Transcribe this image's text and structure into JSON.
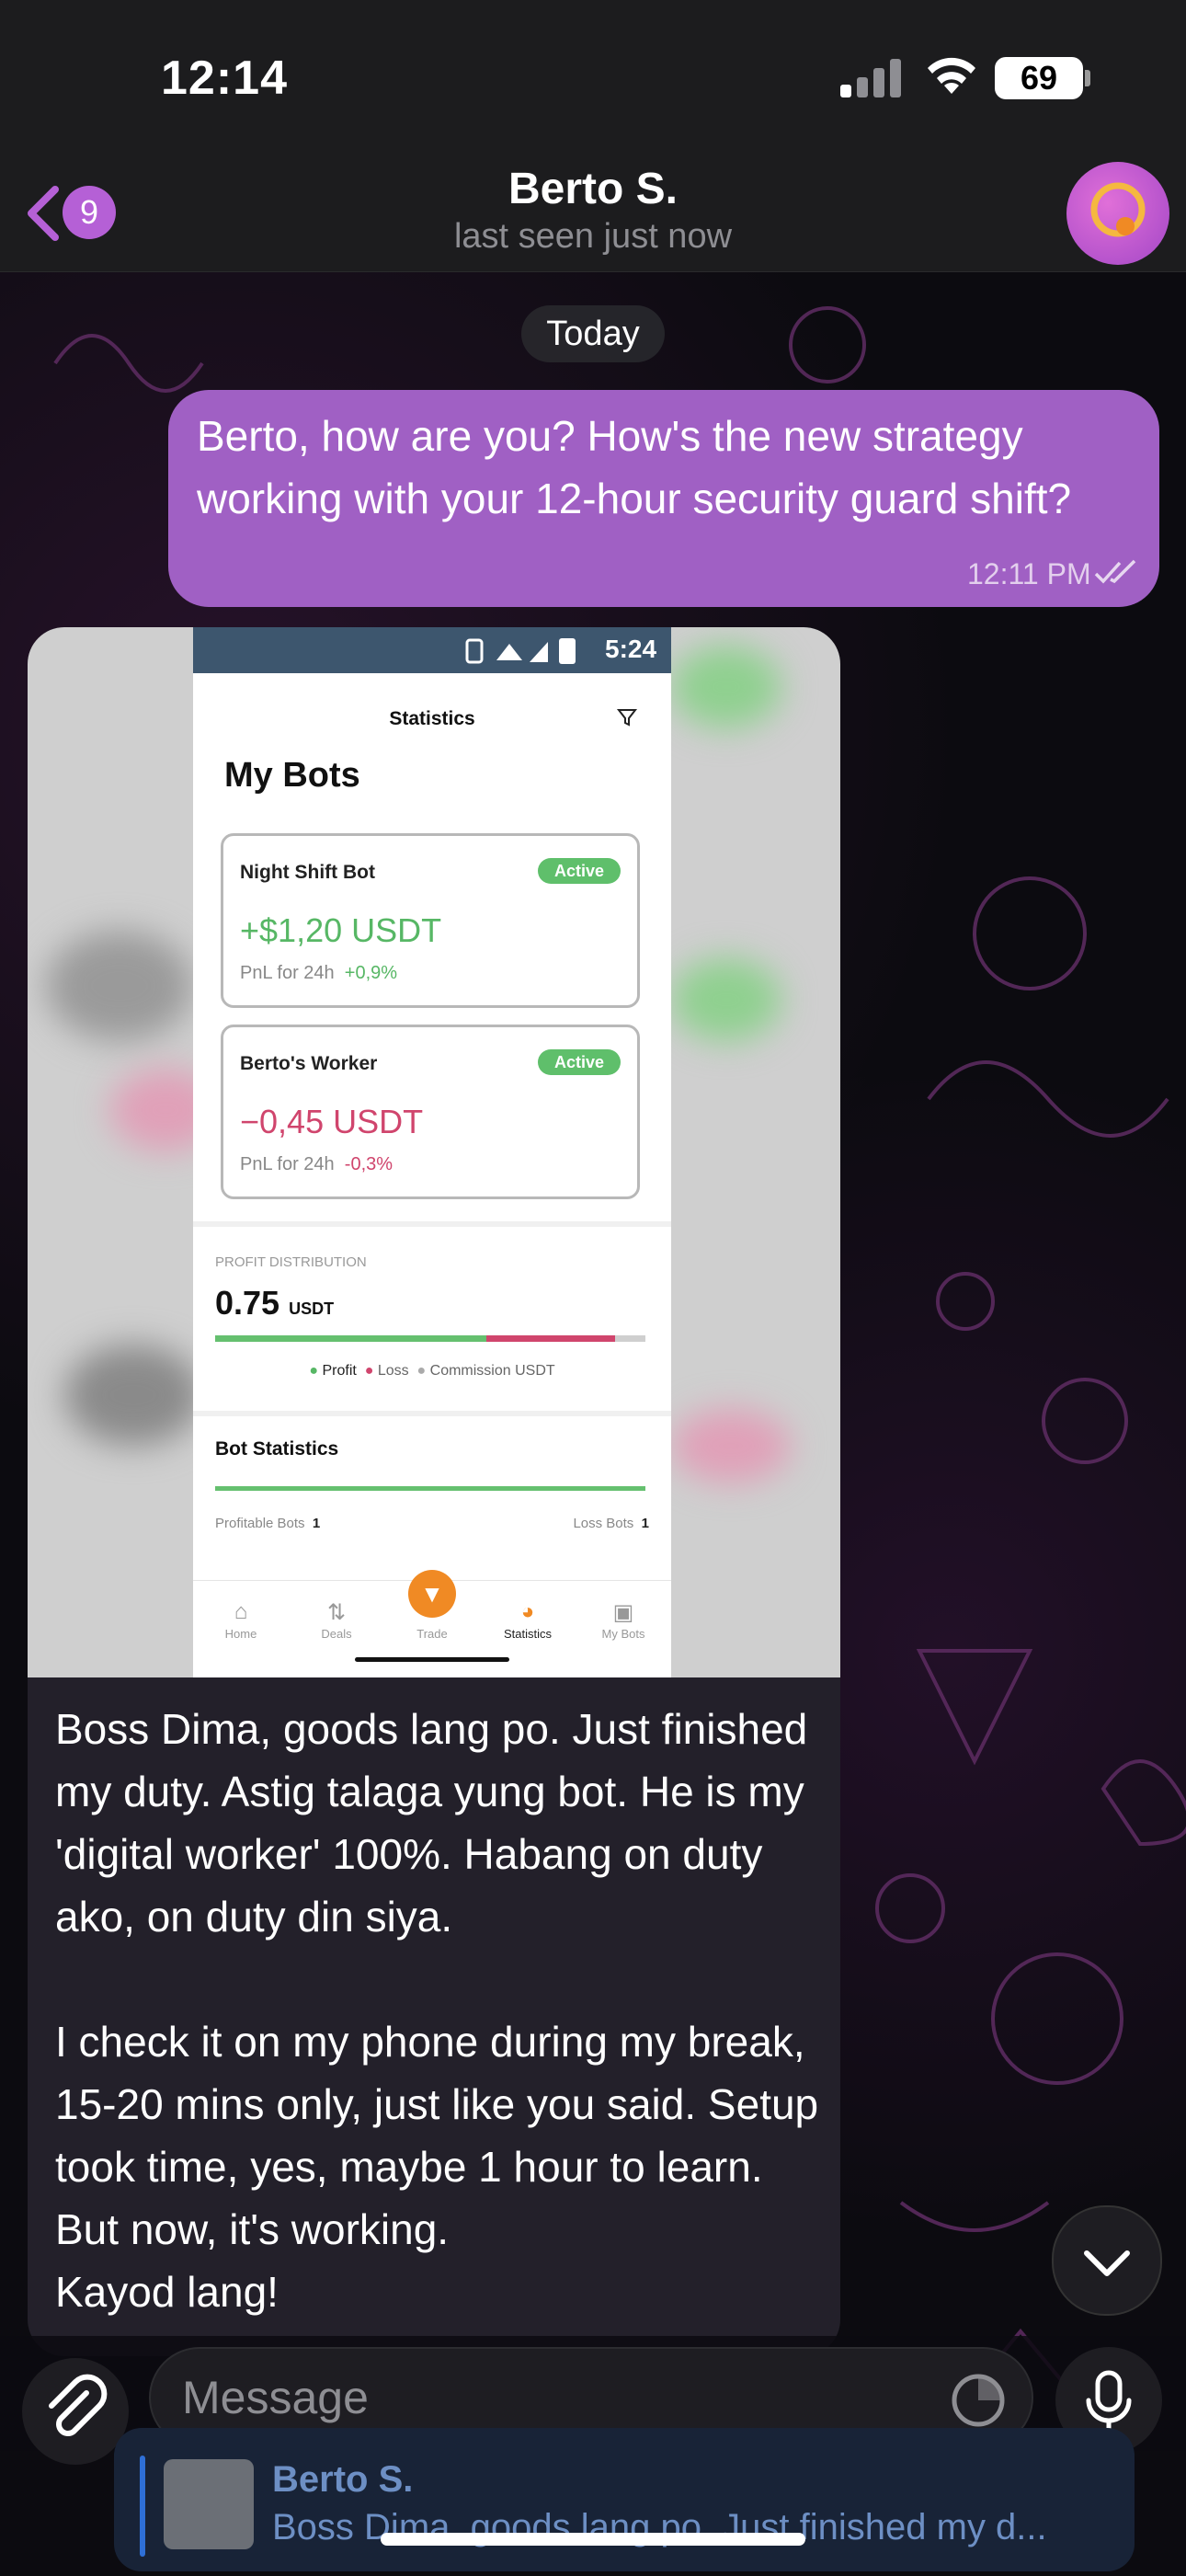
{
  "status_bar": {
    "time": "12:14",
    "battery": "69"
  },
  "header": {
    "back_count": "9",
    "contact_name": "Berto S.",
    "last_seen": "last seen just now"
  },
  "date_separator": "Today",
  "outgoing_message": {
    "text": "Berto, how are you? How's the new strategy working with your 12-hour security guard shift?",
    "time": "12:11 PM"
  },
  "screenshot": {
    "status_time": "5:24",
    "title": "Statistics",
    "heading": "My Bots",
    "bots": [
      {
        "name": "Night Shift Bot",
        "badge": "Active",
        "value": "+$1,20 USDT",
        "pnl_label": "PnL for 24h",
        "pnl_change": "+0,9%"
      },
      {
        "name": "Berto's Worker",
        "badge": "Active",
        "value": "−0,45 USDT",
        "pnl_label": "PnL for 24h",
        "pnl_change": "-0,3%"
      }
    ],
    "profit_distribution": {
      "label": "PROFIT DISTRIBUTION",
      "value": "0.75",
      "unit": "USDT",
      "profit_share": 0.63,
      "loss_share": 0.3,
      "legend_profit": "Profit",
      "legend_loss": "Loss",
      "legend_commission": "Commission USDT"
    },
    "bot_statistics": {
      "title": "Bot Statistics",
      "profitable_label": "Profitable Bots",
      "profitable_count": "1",
      "loss_label": "Loss Bots",
      "loss_count": "1"
    },
    "nav": [
      "Home",
      "Deals",
      "Trade",
      "Statistics",
      "My Bots"
    ]
  },
  "incoming_message": {
    "text": "Boss Dima, goods lang po. Just finished my duty. Astig talaga yung bot. He is my 'digital worker' 100%. Habang on duty ako, on duty din siya.\n\nI check it on my phone during my break, 15-20 mins only, just like you said. Setup took time, yes, maybe 1 hour to learn. But now, it's working.\nKayod lang!"
  },
  "composer": {
    "placeholder": "Message"
  },
  "notification": {
    "name": "Berto S.",
    "preview": "Boss Dima, goods lang po. Just finished my d..."
  },
  "colors": {
    "accent": "#a060c4",
    "badge": "#b560d6",
    "profit": "#57b765",
    "loss": "#d0456d"
  }
}
